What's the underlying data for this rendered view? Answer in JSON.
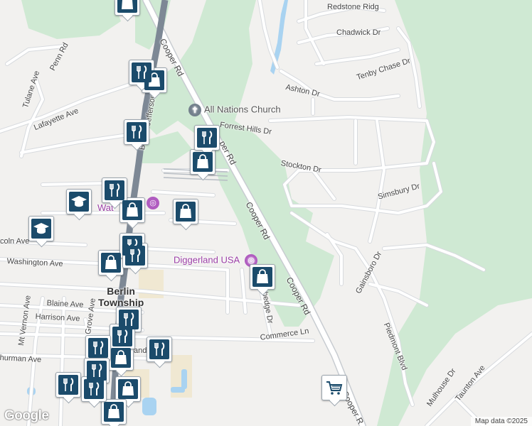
{
  "map": {
    "attribution": "Map data ©2025",
    "logo": "Google",
    "place_labels": {
      "berlin_township": "Berlin\nTownship",
      "all_nations_church": "All Nations Church",
      "diggerland_usa": "Diggerland USA",
      "water_partial": "Wat"
    },
    "street_labels": {
      "redstone_ridge": "Redstone Ridg",
      "chadwick": "Chadwick Dr",
      "tenby_chase": "Tenby Chase Dr",
      "ashton": "Ashton Dr",
      "forrest_hills": "Forrest Hills Dr",
      "stockton": "Stockton Dr",
      "simsbury": "Simsbury Dr",
      "gainsboro": "Gainsboro Dr",
      "piedmont": "Piedmont Blvd",
      "mulhouse": "Mulhouse Dr",
      "taunton": "Taunton Ave",
      "commerce": "Commerce Ln",
      "cooper_1": "Cooper Rd",
      "cooper_2": "Cooper Rd",
      "cooper_3": "Cooper Rd",
      "cooper_4": "Cooper Rd",
      "cooper_5": "Cooper R",
      "cooper_6": "per Rd",
      "tulane": "Tulane Ave",
      "penn": "Penn Rd",
      "lafayette": "Lafayette Ave",
      "washington": "Washington Ave",
      "lincoln": "coln Ave",
      "blaine": "Blaine Ave",
      "harrison": "Harrison Ave",
      "mt_vernon": "Mt Vernon Ave",
      "grove": "Grove Ave",
      "thurman": "hurman Ave",
      "jefferson": "Jefferson",
      "bend_partial": "B",
      "hedge": "hedge Dr",
      "and_partial": "and"
    },
    "icons": {
      "church": "cross-icon",
      "attraction": "camera-icon",
      "shopping": "shopping-bag-icon",
      "restaurant": "fork-knife-icon",
      "school": "graduation-cap-icon",
      "supermarket": "shopping-cart-icon"
    },
    "colors": {
      "land": "#f2f1ef",
      "park": "#cfe9d3",
      "road": "#ffffff",
      "road_border": "#d7dade",
      "rail": "#7d8895",
      "water": "#a9d3f1",
      "pin": "#1b4b6b",
      "purple_poi": "#9a3ea5"
    }
  }
}
